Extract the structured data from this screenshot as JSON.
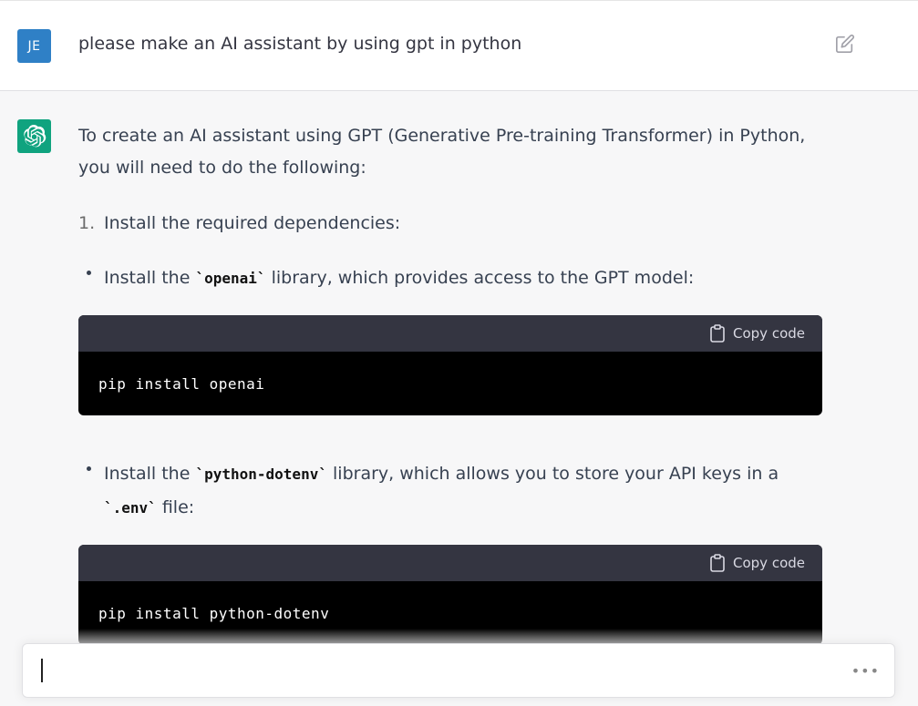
{
  "user_message": {
    "avatar_initials": "JE",
    "text": "please make an AI assistant by using gpt in python",
    "edit_icon": "edit-icon"
  },
  "assistant_message": {
    "avatar_icon": "openai-logo-icon",
    "intro": "To create an AI assistant using GPT (Generative Pre-training Transformer) in Python, you will need to do the following:",
    "steps": [
      {
        "number": "1.",
        "text": "Install the required dependencies:"
      }
    ],
    "bullets": [
      {
        "before": "Install the ",
        "code": "`openai`",
        "after": " library, which provides access to the GPT model:"
      },
      {
        "before": "Install the ",
        "code": "`python-dotenv`",
        "after": " library, which allows you to store your API keys in a ",
        "code2": "`.env`",
        "after2": " file:"
      }
    ],
    "code_blocks": [
      {
        "copy_label": "Copy code",
        "code": "pip install openai"
      },
      {
        "copy_label": "Copy code",
        "code": "pip install python-dotenv"
      }
    ]
  },
  "input": {
    "value": "",
    "more_icon": "more-horizontal-icon"
  },
  "colors": {
    "user_avatar": "#2f80c6",
    "gpt_avatar": "#10a37f",
    "code_header": "#343541",
    "code_body": "#000000",
    "assistant_bg": "#f7f7f8"
  }
}
